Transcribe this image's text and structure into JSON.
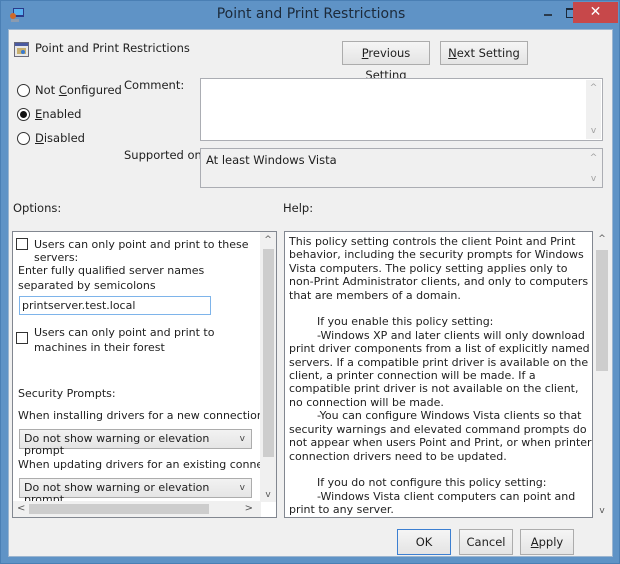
{
  "window": {
    "title": "Point and Print Restrictions",
    "icons": {
      "app": "policy-editor-icon",
      "minimize": "minimize-icon",
      "maximize": "maximize-icon",
      "close": "close-icon"
    },
    "close_glyph": "✕"
  },
  "header": {
    "setting_title": "Point and Print Restrictions",
    "previous_button": {
      "accel": "P",
      "rest": "revious Setting"
    },
    "next_button": {
      "accel": "N",
      "rest": "ext Setting"
    }
  },
  "state": {
    "options": [
      {
        "pre": "Not ",
        "accel": "C",
        "post": "onfigured",
        "checked": false
      },
      {
        "pre": "",
        "accel": "E",
        "post": "nabled",
        "checked": true
      },
      {
        "pre": "",
        "accel": "D",
        "post": "isabled",
        "checked": false
      }
    ]
  },
  "comment": {
    "label": "Comment:",
    "value": ""
  },
  "supported": {
    "label": "Supported on:",
    "value": "At least Windows Vista"
  },
  "options_panel": {
    "label": "Options:",
    "check_servers": {
      "label": "Users can only point and print to these servers:",
      "checked": false
    },
    "servers_hint": "Enter fully qualified server names separated by semicolons",
    "servers_value": "printserver.test.local",
    "check_forest": {
      "label": "Users can only point and print to machines in their forest",
      "checked": false
    },
    "security_label": "Security Prompts:",
    "install_label": "When installing drivers for a new connection:",
    "install_value": "Do not show warning or elevation prompt",
    "update_label": "When updating drivers for an existing connection:",
    "update_value": "Do not show warning or elevation prompt"
  },
  "help_panel": {
    "label": "Help:",
    "text": "This policy setting controls the client Point and Print behavior, including the security prompts for Windows Vista computers. The policy setting applies only to non-Print Administrator clients, and only to computers that are members of a domain.\n\n        If you enable this policy setting:\n        -Windows XP and later clients will only download print driver components from a list of explicitly named servers. If a compatible print driver is available on the client, a printer connection will be made. If a compatible print driver is not available on the client, no connection will be made.\n        -You can configure Windows Vista clients so that security warnings and elevated command prompts do not appear when users Point and Print, or when printer connection drivers need to be updated.\n\n        If you do not configure this policy setting:\n        -Windows Vista client computers can point and print to any server.\n        -Windows Vista computers will show a warning and an elevated command prompt when users create a printer"
  },
  "footer": {
    "ok": "OK",
    "cancel": "Cancel",
    "apply": {
      "accel": "A",
      "rest": "pply"
    }
  },
  "glyphs": {
    "up": "^",
    "down": "v",
    "left": "<",
    "right": ">",
    "chevron": "v"
  }
}
